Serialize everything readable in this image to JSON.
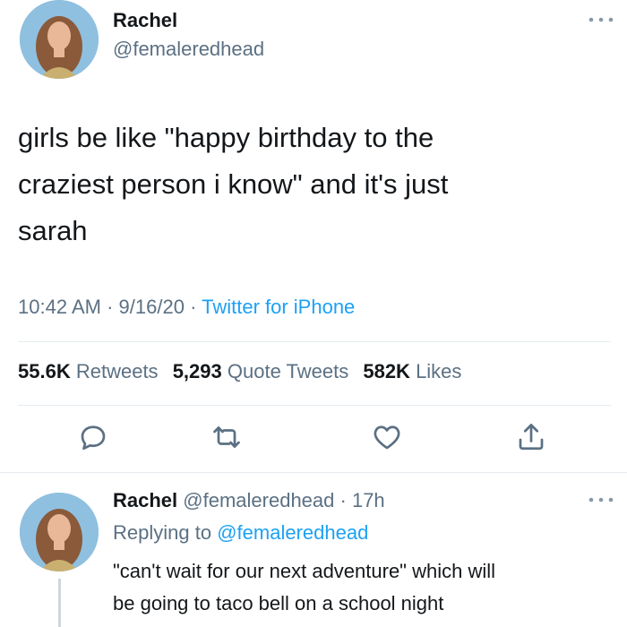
{
  "main_tweet": {
    "display_name": "Rachel",
    "handle": "@femaleredhead",
    "more_icon": "more-horizontal-icon",
    "text_lines": [
      "girls be like \"happy birthday to the",
      "craziest person i know\" and it's just",
      "sarah"
    ],
    "time": "10:42 AM",
    "date": "9/16/20",
    "source": "Twitter for iPhone",
    "stats": {
      "retweets_count": "55.6K",
      "retweets_label": "Retweets",
      "quotes_count": "5,293",
      "quotes_label": "Quote Tweets",
      "likes_count": "582K",
      "likes_label": "Likes"
    },
    "actions": [
      "reply-icon",
      "retweet-icon",
      "like-icon",
      "share-icon"
    ]
  },
  "reply_tweet": {
    "display_name": "Rachel",
    "handle": "@femaleredhead",
    "age": "17h",
    "replying_prefix": "Replying to",
    "replying_to": "@femaleredhead",
    "text_lines": [
      "\"can't wait for our next adventure\" which will",
      "be going to taco bell on a school night"
    ]
  },
  "colors": {
    "text": "#14171a",
    "secondary": "#5b7083",
    "link": "#1da1f2",
    "divider": "#e6ecf0"
  }
}
